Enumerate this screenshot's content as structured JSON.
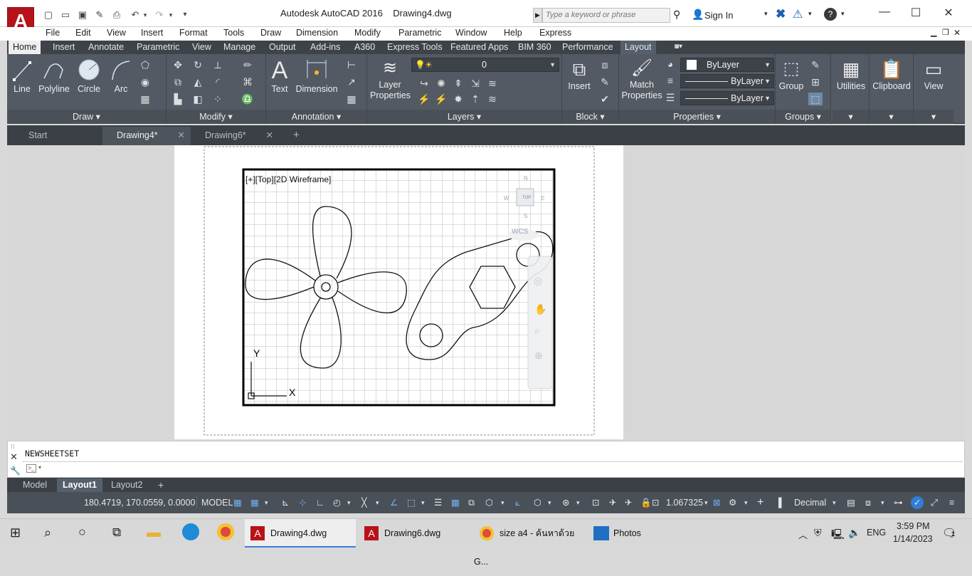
{
  "window": {
    "app_title": "Autodesk AutoCAD 2016",
    "drawing_title": "Drawing4.dwg",
    "search_placeholder": "Type a keyword or phrase",
    "sign_in": "Sign In"
  },
  "menu": [
    "File",
    "Edit",
    "View",
    "Insert",
    "Format",
    "Tools",
    "Draw",
    "Dimension",
    "Modify",
    "Parametric",
    "Window",
    "Help",
    "Express"
  ],
  "ribbon_tabs": [
    "Home",
    "Insert",
    "Annotate",
    "Parametric",
    "View",
    "Manage",
    "Output",
    "Add-ins",
    "A360",
    "Express Tools",
    "Featured Apps",
    "BIM 360",
    "Performance",
    "Layout"
  ],
  "ribbon": {
    "draw": {
      "title": "Draw",
      "line": "Line",
      "polyline": "Polyline",
      "circle": "Circle",
      "arc": "Arc"
    },
    "modify": {
      "title": "Modify"
    },
    "annotation": {
      "title": "Annotation",
      "text": "Text",
      "dimension": "Dimension"
    },
    "layers": {
      "title": "Layers",
      "layer_properties_1": "Layer",
      "layer_properties_2": "Properties",
      "current_layer": "0"
    },
    "block": {
      "title": "Block",
      "insert": "Insert"
    },
    "properties": {
      "title": "Properties",
      "match_1": "Match",
      "match_2": "Properties",
      "color": "ByLayer",
      "linetype": "ByLayer",
      "lineweight": "ByLayer"
    },
    "groups": {
      "title": "Groups",
      "group": "Group"
    },
    "utilities": "Utilities",
    "clipboard": "Clipboard",
    "view": "View"
  },
  "file_tabs": [
    {
      "label": "Start"
    },
    {
      "label": "Drawing4*"
    },
    {
      "label": "Drawing6*"
    }
  ],
  "viewport": {
    "label": "[+][Top][2D Wireframe]",
    "viewcube_top": "TOP",
    "viewcube_n": "N",
    "viewcube_s": "S",
    "viewcube_w": "W",
    "viewcube_e": "E",
    "wcs": "WCS",
    "ucs_x": "X",
    "ucs_y": "Y"
  },
  "command": {
    "history": "NEWSHEETSET"
  },
  "layout_tabs": [
    "Model",
    "Layout1",
    "Layout2"
  ],
  "status": {
    "coords": "180.4719, 170.0559, 0.0000",
    "space": "MODEL",
    "scale": "1.067325",
    "units": "Decimal"
  },
  "taskbar": {
    "apps": [
      "Drawing4.dwg",
      "Drawing6.dwg",
      "size a4 - ค้นหาด้วย G...",
      "Photos"
    ],
    "lang": "ENG",
    "time": "3:59 PM",
    "date": "1/14/2023",
    "notifications": "1"
  }
}
